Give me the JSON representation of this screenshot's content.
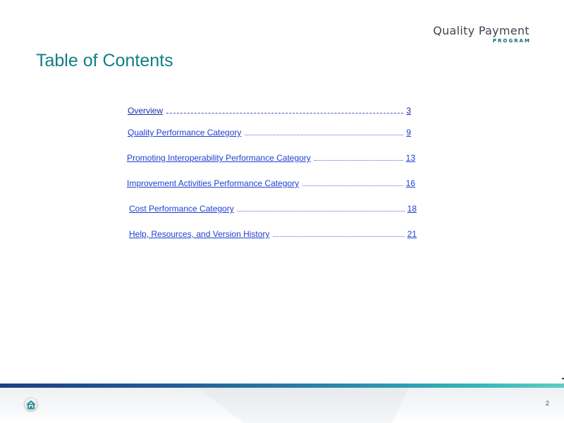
{
  "logo": {
    "main": "Quality Payment",
    "sub": "PROGRAM"
  },
  "title": "Table of Contents",
  "toc": [
    {
      "label": "Overview",
      "page": "3"
    },
    {
      "label": "Quality Performance Category",
      "page": "9"
    },
    {
      "label": "Promoting Interoperability Performance Category",
      "page": "13"
    },
    {
      "label": "Improvement Activities Performance Category",
      "page": "16"
    },
    {
      "label": "Cost Performance Category",
      "page": "18"
    },
    {
      "label": "Help, Resources, and Version History",
      "page": "21"
    }
  ],
  "footer": {
    "page_number": "2",
    "home_icon": "home-icon"
  },
  "colors": {
    "title": "#127e86",
    "link": "#1f3fd0",
    "logo_text": "#3d4551",
    "logo_accent": "#0a6a6f"
  }
}
